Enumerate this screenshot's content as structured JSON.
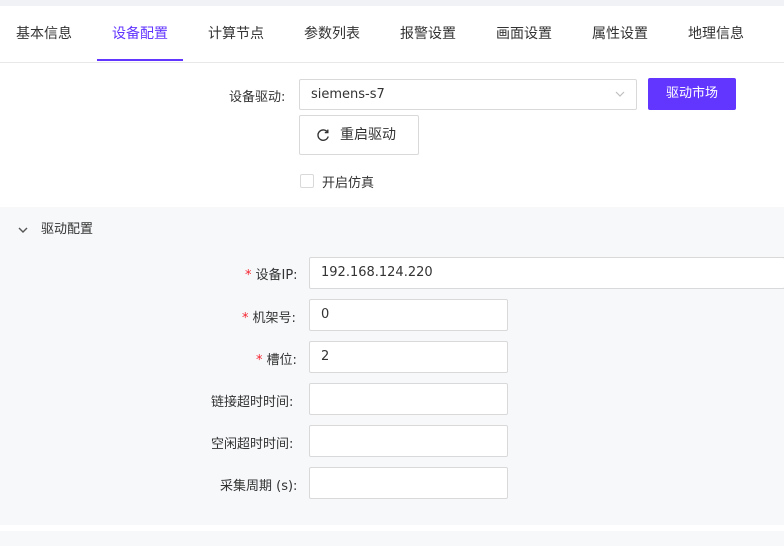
{
  "tabs": [
    {
      "label": "基本信息"
    },
    {
      "label": "设备配置"
    },
    {
      "label": "计算节点"
    },
    {
      "label": "参数列表"
    },
    {
      "label": "报警设置"
    },
    {
      "label": "画面设置"
    },
    {
      "label": "属性设置"
    },
    {
      "label": "地理信息"
    }
  ],
  "active_tab": "设备配置",
  "driver": {
    "label": "设备驱动:",
    "value": "siemens-s7",
    "market_button": "驱动市场",
    "restart_button": "重启驱动",
    "simulation_label": "开启仿真",
    "simulation_checked": false
  },
  "driver_config": {
    "title": "驱动配置",
    "required_mark": "*",
    "fields": [
      {
        "label": "设备IP:",
        "value": "192.168.124.220",
        "required": true
      },
      {
        "label": "机架号:",
        "value": "0",
        "required": true
      },
      {
        "label": "槽位:",
        "value": "2",
        "required": true
      },
      {
        "label": "链接超时时间:",
        "value": "",
        "required": false
      },
      {
        "label": "空闲超时时间:",
        "value": "",
        "required": false
      },
      {
        "label": "采集周期 (s):",
        "value": "",
        "required": false
      }
    ]
  },
  "colors": {
    "accent": "#6236ff",
    "required": "#f5222d",
    "panel_bg": "#f7f8fa"
  }
}
